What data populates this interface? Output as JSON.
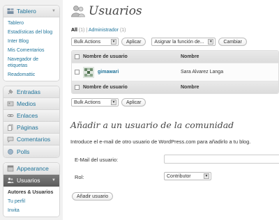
{
  "sidebar": {
    "dashboard": {
      "label": "Tablero",
      "subitems": [
        "Tablero",
        "Estadísticas del blog",
        "Inter Blog",
        "Mis Comentarios",
        "Navegador de etiquetas",
        "Readomattic"
      ]
    },
    "content": [
      "Entradas",
      "Medios",
      "Enlaces",
      "Páginas",
      "Comentarios",
      "Polls"
    ],
    "appearance_label": "Appearance",
    "users": {
      "label": "Usuarios",
      "subitems": [
        "Autores & Usuarios",
        "Tu perfil",
        "Invita"
      ]
    }
  },
  "main": {
    "title": "Usuarios",
    "filters": {
      "all_label": "All",
      "all_count": "(1)",
      "separator": "|",
      "admin_label": "Administrador",
      "admin_count": "(1)"
    },
    "top_nav": {
      "bulk_actions": "Bulk Actions",
      "apply": "Aplicar",
      "assign_role": "Asignar la función de...",
      "change": "Cambiar"
    },
    "table": {
      "headers": [
        "Nombre de usuario",
        "Nombre"
      ],
      "rows": [
        {
          "username": "gimawari",
          "name": "Sara Alvarez Langa"
        }
      ]
    },
    "bottom_nav": {
      "bulk_actions": "Bulk Actions",
      "apply": "Aplicar"
    },
    "add_user": {
      "heading": "Añadir a un usuario de la comunidad",
      "intro": "Introduce el e-mail de otro usuario de WordPress.com para añadirlo a tu blog.",
      "email_label": "E-Mail del usuario:",
      "email_value": "",
      "role_label": "Rol:",
      "role_value": "Contributor",
      "submit": "Añadir usuario"
    }
  },
  "colors": {
    "link": "#21759b",
    "sidebar_bg": "#f1f1f1",
    "open_menu": "#6d6d6d"
  }
}
